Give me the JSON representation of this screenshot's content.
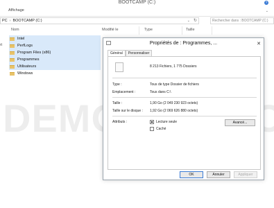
{
  "window": {
    "title": "BOOTCAMP (C:)",
    "help_glyph": "?"
  },
  "ribbon": {
    "tab_label": "Affichage",
    "expand_glyph": "⌄"
  },
  "address": {
    "parts": [
      "PC",
      "BOOTCAMP (C:)"
    ],
    "separator": "›",
    "dropdown_glyph": "⌄",
    "refresh_glyph": "↻"
  },
  "search": {
    "placeholder": "Rechercher dans : BOOTCAMP (C:)"
  },
  "columns": {
    "name": "Nom",
    "modified": "Modifié le",
    "type": "Type",
    "size": "Taille"
  },
  "left_pane": {
    "label": "rt"
  },
  "files": [
    {
      "name": "Intel",
      "selected": true
    },
    {
      "name": "PerfLogs",
      "selected": true
    },
    {
      "name": "Program Files (x86)",
      "selected": true
    },
    {
      "name": "Programmes",
      "selected": true
    },
    {
      "name": "Utilisateurs",
      "selected": true
    },
    {
      "name": "Windows",
      "selected": false
    }
  ],
  "watermark": "DEMO VERSION",
  "dialog": {
    "title": "Propriétés de : Programmes, ...",
    "close_glyph": "✕",
    "tabs": [
      "Général",
      "Personnaliser"
    ],
    "summary": "8 213 Fichiers, 1 775 Dossiers",
    "type_label": "Type :",
    "type_value": "Tous de type Dossier de fichiers",
    "location_label": "Emplacement :",
    "location_value": "Tous dans C:\\",
    "size_label": "Taille :",
    "size_value": "1,90 Go (2 049 230 923 octets)",
    "disk_label": "Taille sur le disque :",
    "disk_value": "1,92 Go (2 069 626 880 octets)",
    "attributes_label": "Attributs :",
    "readonly_label": "Lecture seule",
    "hidden_label": "Caché",
    "advanced_label": "Avancé...",
    "ok_label": "OK",
    "cancel_label": "Annuler",
    "apply_label": "Appliquer"
  }
}
